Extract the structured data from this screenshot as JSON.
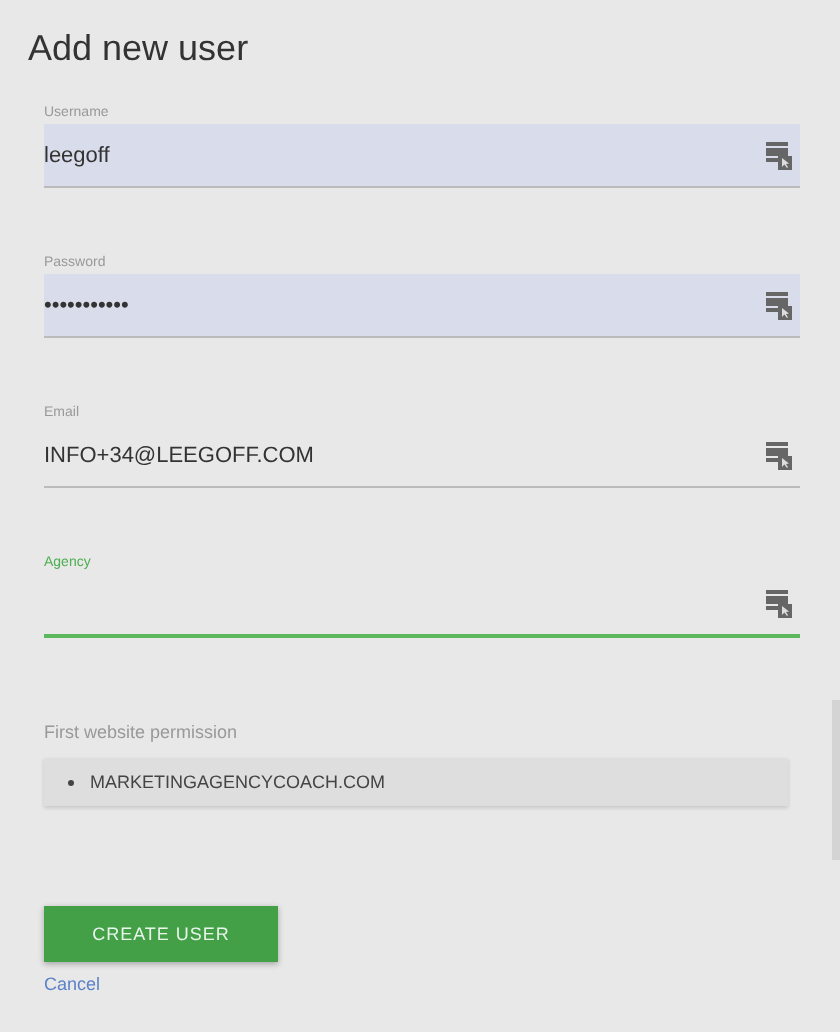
{
  "title": "Add new user",
  "fields": [
    {
      "label": "Username",
      "value": "leegoff",
      "autofilled": true,
      "focused": false
    },
    {
      "label": "Password",
      "value": "•••••••••••",
      "autofilled": true,
      "focused": false
    },
    {
      "label": "Email",
      "value": "INFO+34@LEEGOFF.COM",
      "autofilled": false,
      "focused": false
    },
    {
      "label": "Agency",
      "autofilled": false,
      "focused": true
    }
  ],
  "permission": {
    "label": "First website permission",
    "items": [
      "MARKETINGAGENCYCOACH.COM"
    ]
  },
  "buttons": {
    "create": "CREATE USER",
    "cancel": "Cancel"
  }
}
